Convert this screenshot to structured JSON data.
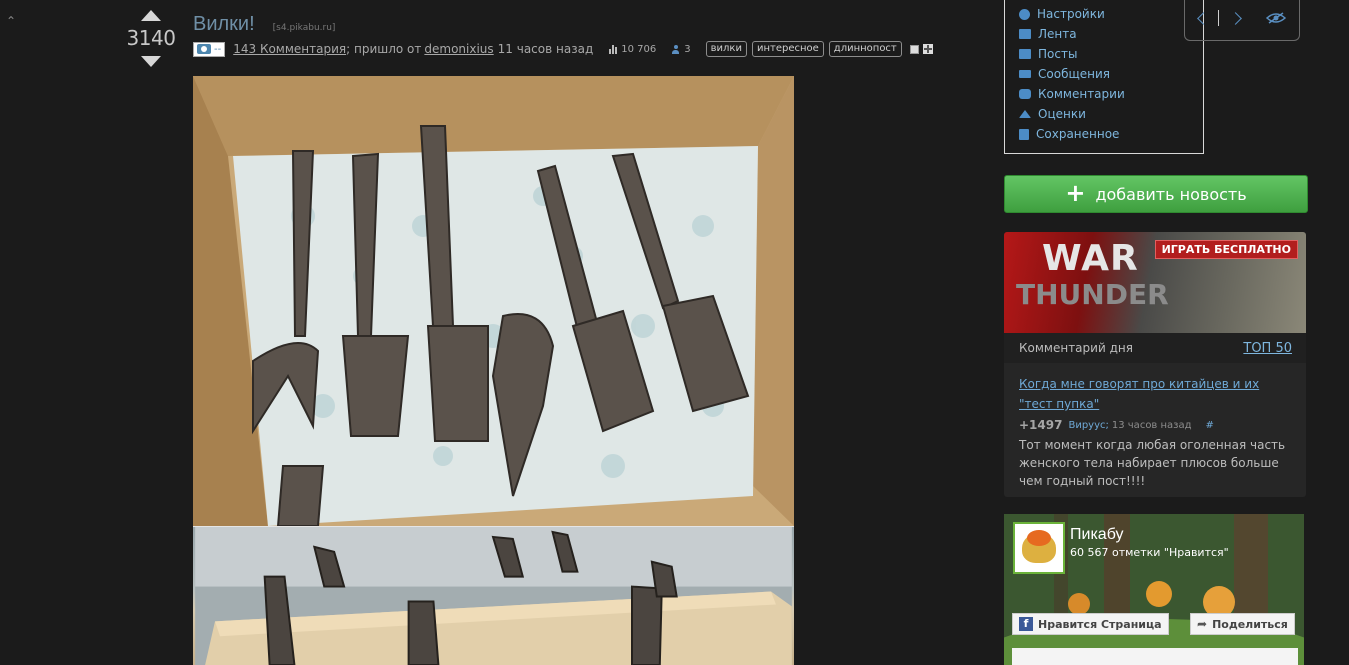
{
  "vote": {
    "score": "3140"
  },
  "post": {
    "title": "Вилки!",
    "domain": "[s4.pikabu.ru]",
    "media_dash": "--",
    "comments_link": "143 Комментария",
    "via_text": "; пришло от",
    "author": "demonixius",
    "time": "11 часов назад",
    "views": "10 706",
    "saves": "3",
    "tags": [
      "вилки",
      "интересное",
      "длиннопост"
    ]
  },
  "user_menu": {
    "items": [
      {
        "label": "Настройки",
        "icon": "gear-icon"
      },
      {
        "label": "Лента",
        "icon": "feed-icon"
      },
      {
        "label": "Посты",
        "icon": "posts-icon"
      },
      {
        "label": "Сообщения",
        "icon": "mail-icon"
      },
      {
        "label": "Комментарии",
        "icon": "comments-icon"
      },
      {
        "label": "Оценки",
        "icon": "rating-icon"
      },
      {
        "label": "Сохраненное",
        "icon": "save-icon"
      }
    ]
  },
  "add_news": {
    "label": "добавить новость"
  },
  "ad": {
    "war": "WAR",
    "thunder": "THUNDER",
    "cta": "ИГРАТЬ БЕСПЛАТНО"
  },
  "comment_of_day": {
    "title": "Комментарий дня",
    "top_link": "ТОП 50",
    "post_link": "Когда мне говорят про китайцев и их \"тест пупка\"",
    "score": "+1497",
    "author": "Вируус;",
    "time": "13 часов назад",
    "hash": "#",
    "text": "Тот момент когда любая оголенная часть женского тела набирает плюсов больше чем годный пост!!!!"
  },
  "facebook": {
    "page_name": "Пикабу",
    "likes": "60 567 отметки \"Нравится\"",
    "like_btn": "Нравится Страница",
    "share_btn": "Поделиться"
  },
  "colors": {
    "background": "#1b1b1b",
    "link": "#6fa9d6",
    "title": "#6f8fa6",
    "add_button": "#4fb34f"
  }
}
